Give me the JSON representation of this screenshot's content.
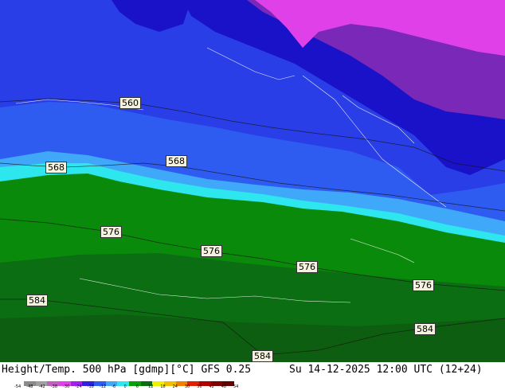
{
  "map": {
    "contour_labels": [
      "560",
      "568",
      "568",
      "576",
      "576",
      "576",
      "576",
      "584",
      "584",
      "584"
    ],
    "colors": {
      "deep_blue": "#1a12c8",
      "blue": "#2f5cf0",
      "light_blue": "#3fa8f8",
      "cyan": "#2ee6ee",
      "green": "#0a8a0a",
      "dark_green": "#0b6e12",
      "magenta": "#e040e8",
      "purple": "#7a28b8"
    }
  },
  "footer": {
    "title": "Height/Temp. 500 hPa [gdmp][°C] GFS 0.25",
    "datetime": "Su 14-12-2025 12:00 UTC (12+24)",
    "legend_ticks": [
      "-54",
      "-48",
      "-42",
      "-38",
      "-30",
      "-24",
      "-18",
      "-12",
      "-6",
      "0",
      "6",
      "12",
      "18",
      "24",
      "30",
      "36",
      "42",
      "48",
      "54"
    ],
    "legend_colors": [
      "#8a8a8a",
      "#a0a0a0",
      "#c060c0",
      "#e040e8",
      "#a020f0",
      "#3020e0",
      "#2f5cf0",
      "#3fa8f8",
      "#2ee6ee",
      "#0aa00a",
      "#0b6e12",
      "#f0f000",
      "#f0c000",
      "#f08000",
      "#e02000",
      "#b00000",
      "#800000",
      "#600000"
    ]
  }
}
